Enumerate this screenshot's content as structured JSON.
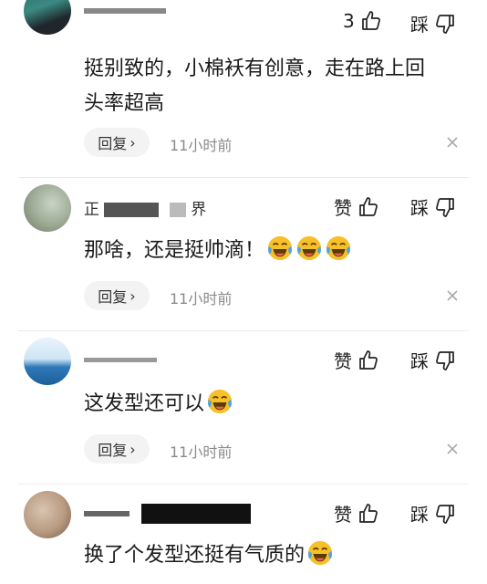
{
  "comments": [
    {
      "username": "",
      "like_count": "3",
      "dislike_label": "踩",
      "text": "挺别致的，小棉袄有创意，走在路上回头率超高",
      "text_line1": "挺别致的，小棉袄有创意，走在路上回",
      "text_line2": "头率超高",
      "reply_label": "回复",
      "reply_chevron": "›",
      "time": "11小时前"
    },
    {
      "username": "正**界",
      "username_part1": "正",
      "username_part2": "界",
      "like_label": "赞",
      "dislike_label": "踩",
      "text": "那啥，还是挺帅滴！",
      "reply_label": "回复",
      "reply_chevron": "›",
      "time": "11小时前"
    },
    {
      "username": "",
      "like_label": "赞",
      "dislike_label": "踩",
      "text": "这发型还可以",
      "reply_label": "回复",
      "reply_chevron": "›",
      "time": "11小时前"
    },
    {
      "username": "",
      "like_label": "赞",
      "dislike_label": "踩",
      "text": "换了个发型还挺有气质的"
    }
  ],
  "icons": {
    "like": "thumbs-up-icon",
    "dislike": "thumbs-down-icon",
    "close": "close-icon",
    "emoji": "laughing-crying-emoji"
  },
  "colors": {
    "text": "#1a1a1a",
    "muted": "#8a8a8a",
    "reply_bg": "#f3f3f3",
    "emoji_face": "#f7c02a",
    "emoji_tear": "#4aa3ea"
  }
}
